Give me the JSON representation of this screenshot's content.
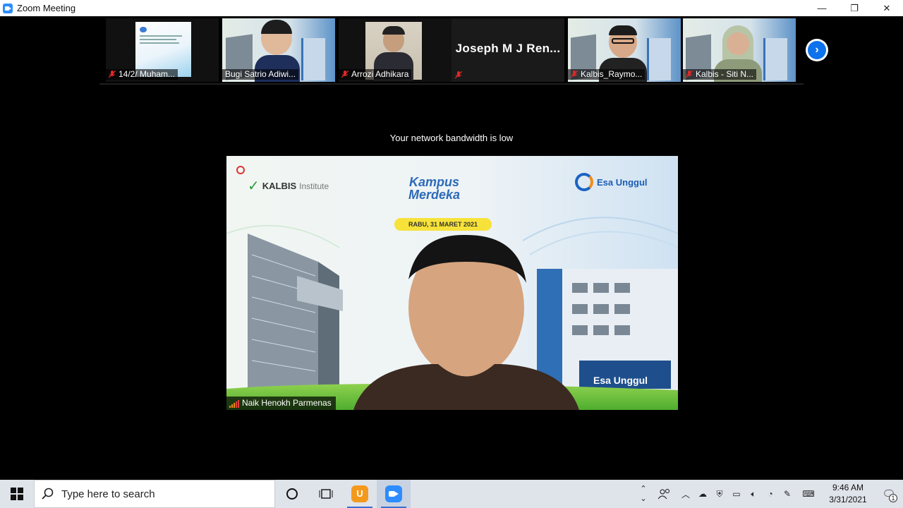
{
  "window": {
    "title": "Zoom Meeting",
    "controls": {
      "minimize": "—",
      "restore": "❐",
      "close": "✕"
    }
  },
  "participants": [
    {
      "name": "14/2/ Muham...",
      "muted": true
    },
    {
      "name": "Bugi Satrio Adiwi...",
      "muted": false
    },
    {
      "name": "Arrozi Adhikara",
      "muted": true
    },
    {
      "name": "Joseph  M J Ren...",
      "muted": true,
      "video_off": true
    },
    {
      "name": "Kalbis_Raymo...",
      "muted": true
    },
    {
      "name": "Kalbis - Siti N...",
      "muted": true
    }
  ],
  "next_page_icon": "chevron-right-icon",
  "stage": {
    "network_message": "Your network bandwidth is low",
    "speaker_name": "Naik Henokh Parmenas",
    "background": {
      "logo_left": "KALBIS",
      "logo_left_sub": "Institute",
      "logo_center_line1": "Kampus",
      "logo_center_line2": "Merdeka",
      "date_banner": "RABU, 31 MARET 2021",
      "logo_right": "Esa Unggul",
      "building_sign": "Esa Unggul"
    }
  },
  "taskbar": {
    "search_placeholder": "Type here to search",
    "time": "9:46 AM",
    "date": "3/31/2021",
    "notification_count": "1"
  },
  "colors": {
    "zoom_blue": "#0e72ed",
    "mute_red": "#e02828",
    "taskbar_bg": "#dfe3ea"
  }
}
